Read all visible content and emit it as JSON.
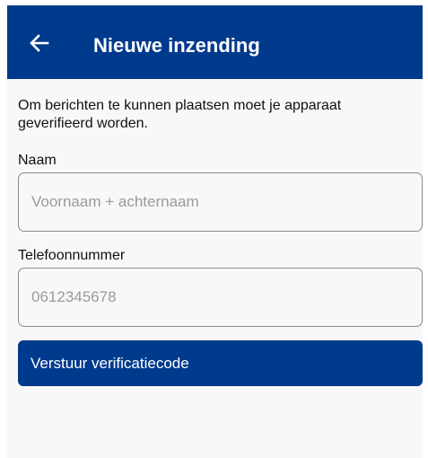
{
  "theme": {
    "primary_color": "#003a8c",
    "background_color": "#f8f8f8",
    "border_color": "#8a8a8a",
    "placeholder_color": "#9a9a9a"
  },
  "appbar": {
    "back_icon": "arrow-left-icon",
    "title": "Nieuwe inzending"
  },
  "form": {
    "intro_text": "Om berichten te kunnen plaatsen moet je apparaat geverifieerd worden.",
    "name_field": {
      "label": "Naam",
      "value": "",
      "placeholder": "Voornaam + achternaam"
    },
    "phone_field": {
      "label": "Telefoonnummer",
      "value": "",
      "placeholder": "0612345678"
    },
    "submit_label": "Verstuur verificatiecode"
  }
}
